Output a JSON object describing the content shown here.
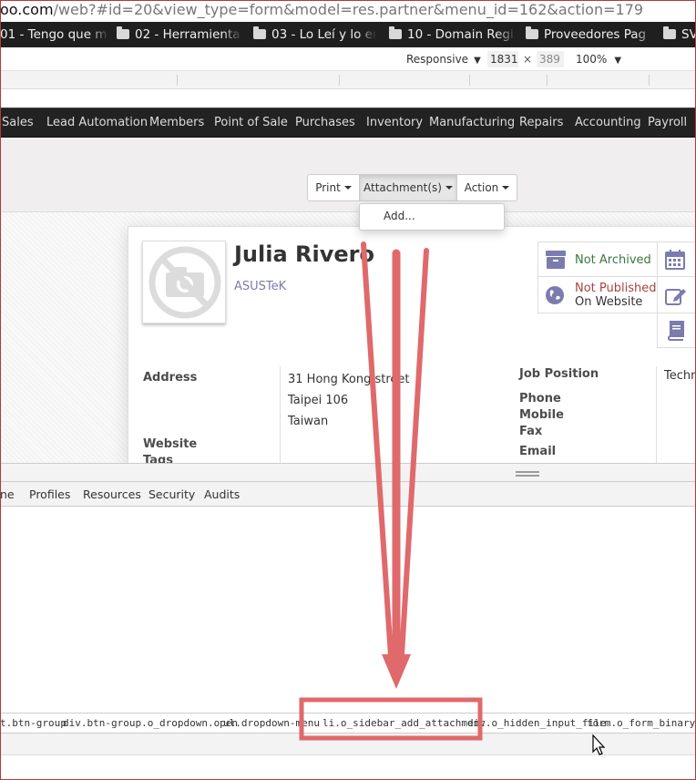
{
  "browser": {
    "url_host": "oo.com",
    "url_path": "/web?#id=20&view_type=form&model=res.partner&menu_id=162&action=179"
  },
  "bookmarks": [
    {
      "label": "01 - Tengo que m"
    },
    {
      "label": "02 - Herramienta"
    },
    {
      "label": "03 - Lo Leí y lo en"
    },
    {
      "label": "10 - Domain Regi"
    },
    {
      "label": "Proveedores Pag"
    },
    {
      "label": "SV"
    }
  ],
  "device_toolbar": {
    "mode": "Responsive",
    "width": "1831",
    "times": "×",
    "height": "389",
    "zoom": "100%"
  },
  "app_menu": [
    "Sales",
    "Lead Automation",
    "Members",
    "Point of Sale",
    "Purchases",
    "Inventory",
    "Manufacturing",
    "Repairs",
    "Accounting",
    "Payroll"
  ],
  "control_panel": {
    "print_label": "Print",
    "attachments_label": "Attachment(s)",
    "action_label": "Action",
    "dropdown_add": "Add..."
  },
  "record": {
    "name": "Julia Rivero",
    "company": "ASUSTeK",
    "archived_status": "Not Archived",
    "published_line1": "Not Published",
    "published_line2": "On Website",
    "address_label": "Address",
    "street": "31 Hong Kong street",
    "city": "Taipei 106",
    "country": "Taiwan",
    "website_label": "Website",
    "tags_label": "Tags",
    "job_position_label": "Job Position",
    "job_position_value": "Techn",
    "phone_label": "Phone",
    "mobile_label": "Mobile",
    "fax_label": "Fax",
    "email_label": "Email"
  },
  "devtools_tabs": [
    "ne",
    "Profiles",
    "Resources",
    "Security",
    "Audits"
  ],
  "breadcrumbs": [
    "t.btn-group",
    "div.btn-group.o_dropdown.open",
    "ul.dropdown-menu",
    "li.o_sidebar_add_attachment",
    "div.o_hidden_input_file",
    "form.o_form_binary_for"
  ],
  "colors": {
    "annotation": "#e0696b",
    "menu_bg": "#222222",
    "archived_green": "#3c763d",
    "unpublished_red": "#a94442",
    "odoo_purple": "#7c7bad",
    "icon_purple": "#7c7bad"
  }
}
